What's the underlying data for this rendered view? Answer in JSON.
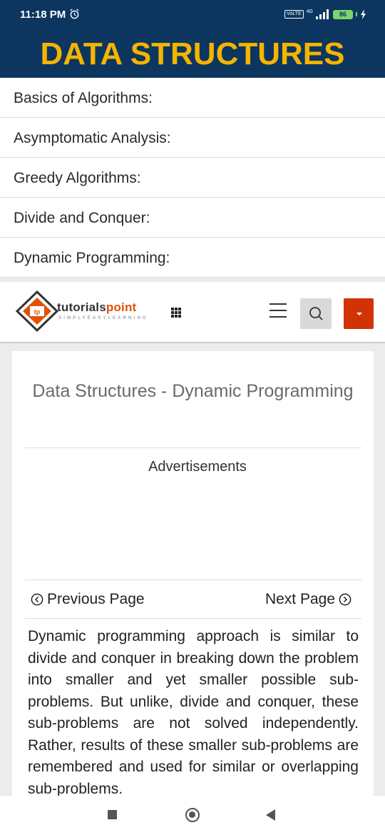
{
  "status_bar": {
    "time": "11:18 PM",
    "network_type": "4G",
    "volte": "VoLTE",
    "battery": "86"
  },
  "header": {
    "title": "DATA STRUCTURES"
  },
  "menu": {
    "items": [
      {
        "label": "Basics of Algorithms:"
      },
      {
        "label": "Asymptomatic Analysis:"
      },
      {
        "label": "Greedy Algorithms:"
      },
      {
        "label": "Divide and Conquer:"
      },
      {
        "label": "Dynamic Programming:"
      }
    ]
  },
  "site": {
    "logo_main": "tutorials",
    "logo_accent": "point",
    "tagline": "SIMPLYEASYLEARNING",
    "accent_color": "#d13307"
  },
  "article": {
    "title": "Data Structures - Dynamic Programming",
    "ads_label": "Advertisements",
    "prev_label": "Previous Page",
    "next_label": "Next Page",
    "paragraph": "Dynamic programming approach is similar to divide and conquer in breaking down the problem into smaller and yet smaller possible sub-problems. But unlike, divide and conquer, these sub-problems are not solved independently. Rather, results of these smaller sub-problems are remembered and used for similar or overlapping sub-problems."
  },
  "icons": {
    "alarm": "alarm-icon",
    "signal": "signal-icon",
    "battery": "battery-icon",
    "charging": "charging-icon",
    "logo": "tutorialspoint-logo",
    "grid": "grid-icon",
    "menu": "hamburger-icon",
    "search": "search-icon",
    "caret": "caret-down-icon",
    "prev": "chevron-left-circle-icon",
    "next": "chevron-right-circle-icon",
    "nav_recents": "recents-icon",
    "nav_home": "home-icon",
    "nav_back": "back-icon"
  }
}
